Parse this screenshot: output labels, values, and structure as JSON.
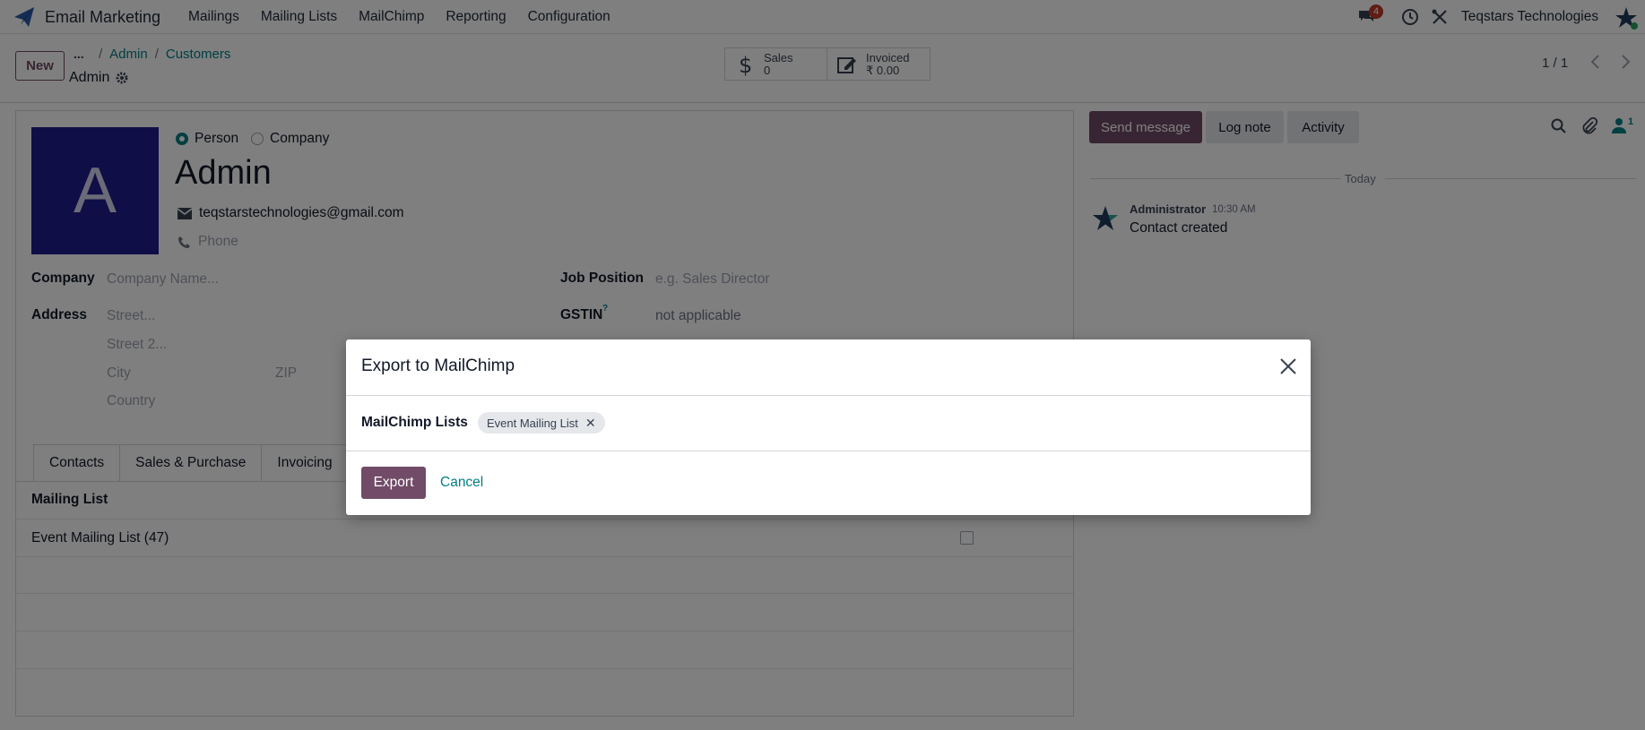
{
  "navbar": {
    "app_name": "Email Marketing",
    "menu": [
      "Mailings",
      "Mailing Lists",
      "MailChimp",
      "Reporting",
      "Configuration"
    ],
    "chat_badge": "4",
    "company": "Teqstars Technologies"
  },
  "control_panel": {
    "new_label": "New",
    "breadcrumb_dots": "...",
    "breadcrumb": [
      "Admin",
      "Customers"
    ],
    "record_name": "Admin",
    "smart_buttons": {
      "sales": {
        "label": "Sales",
        "value": "0"
      },
      "invoiced": {
        "label": "Invoiced",
        "value": "₹ 0.00"
      }
    },
    "pager": "1 / 1"
  },
  "form": {
    "avatar_letter": "A",
    "type_person": "Person",
    "type_company": "Company",
    "name": "Admin",
    "email": "teqstarstechnologies@gmail.com",
    "phone_placeholder": "Phone",
    "company_label": "Company",
    "company_placeholder": "Company Name...",
    "address_label": "Address",
    "street_placeholder": "Street...",
    "street2_placeholder": "Street 2...",
    "city_placeholder": "City",
    "zip_placeholder": "ZIP",
    "country_placeholder": "Country",
    "job_label": "Job Position",
    "job_placeholder": "e.g. Sales Director",
    "gstin_label": "GSTIN",
    "gstin_help": "?",
    "gstin_value": "not applicable",
    "tabs": [
      "Contacts",
      "Sales & Purchase",
      "Invoicing"
    ],
    "mailing_list_header": "Mailing List",
    "mailing_list_rows": [
      "Event Mailing List (47)"
    ]
  },
  "chatter": {
    "send_label": "Send message",
    "log_label": "Log note",
    "activity_label": "Activity",
    "follower_count": "1",
    "today": "Today",
    "message": {
      "author": "Administrator",
      "time": "10:30 AM",
      "body": "Contact created"
    }
  },
  "modal": {
    "title": "Export to MailChimp",
    "field_label": "MailChimp Lists",
    "tag": "Event Mailing List",
    "export_label": "Export",
    "cancel_label": "Cancel"
  },
  "colors": {
    "primary": "#714b67",
    "link": "#017e84",
    "avatar_bg": "#1e1c8f",
    "badge": "#c0392b"
  }
}
